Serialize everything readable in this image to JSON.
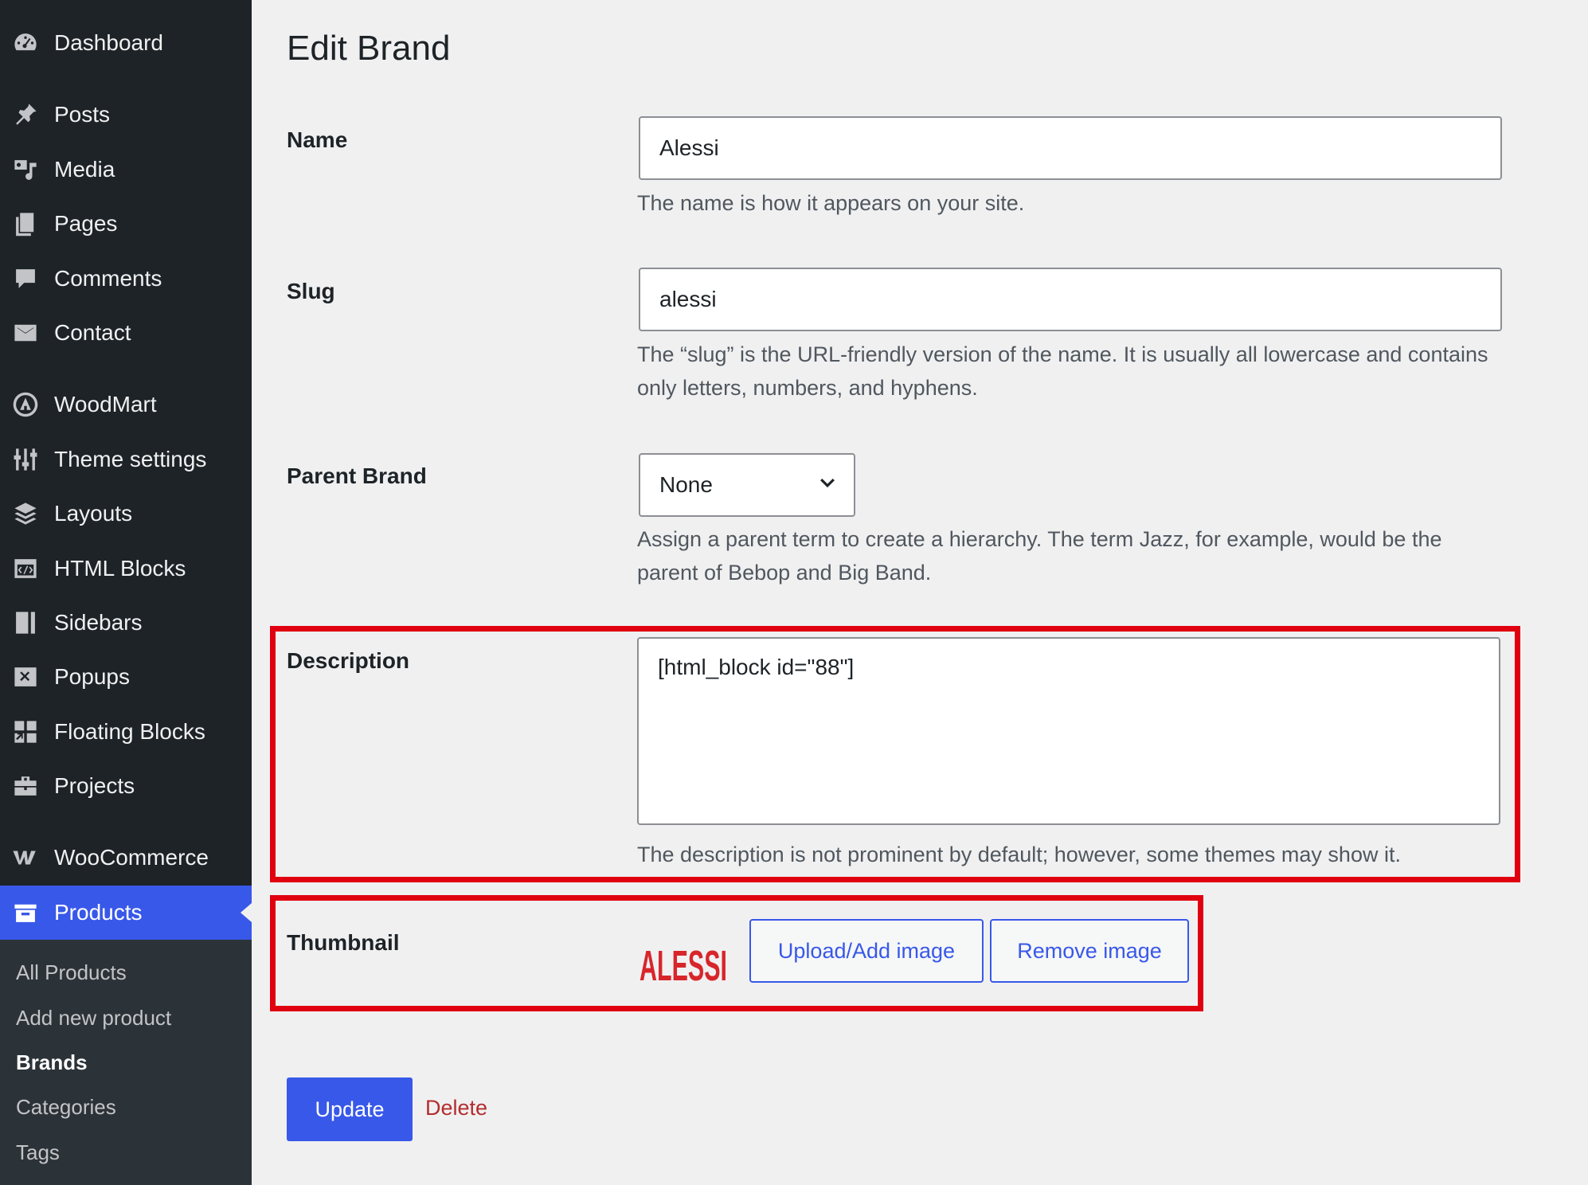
{
  "sidebar": {
    "items": [
      {
        "label": "Dashboard",
        "icon": "dashboard-icon"
      },
      {
        "label": "Posts",
        "icon": "pin-icon"
      },
      {
        "label": "Media",
        "icon": "media-icon"
      },
      {
        "label": "Pages",
        "icon": "pages-icon"
      },
      {
        "label": "Comments",
        "icon": "comment-icon"
      },
      {
        "label": "Contact",
        "icon": "envelope-icon"
      },
      {
        "label": "WoodMart",
        "icon": "woodmart-icon"
      },
      {
        "label": "Theme settings",
        "icon": "sliders-icon"
      },
      {
        "label": "Layouts",
        "icon": "layers-icon"
      },
      {
        "label": "HTML Blocks",
        "icon": "code-block-icon"
      },
      {
        "label": "Sidebars",
        "icon": "sidebar-icon"
      },
      {
        "label": "Popups",
        "icon": "popup-icon"
      },
      {
        "label": "Floating Blocks",
        "icon": "floating-blocks-icon"
      },
      {
        "label": "Projects",
        "icon": "briefcase-icon"
      },
      {
        "label": "WooCommerce",
        "icon": "woocommerce-icon"
      },
      {
        "label": "Products",
        "icon": "products-icon",
        "active": true
      }
    ],
    "submenu": [
      {
        "label": "All Products"
      },
      {
        "label": "Add new product"
      },
      {
        "label": "Brands",
        "current": true
      },
      {
        "label": "Categories"
      },
      {
        "label": "Tags"
      }
    ]
  },
  "page": {
    "title": "Edit Brand"
  },
  "form": {
    "name": {
      "label": "Name",
      "value": "Alessi",
      "help": "The name is how it appears on your site."
    },
    "slug": {
      "label": "Slug",
      "value": "alessi",
      "help": "The “slug” is the URL-friendly version of the name. It is usually all lowercase and contains only letters, numbers, and hyphens."
    },
    "parent": {
      "label": "Parent Brand",
      "selected": "None",
      "help": "Assign a parent term to create a hierarchy. The term Jazz, for example, would be the parent of Bebop and Big Band."
    },
    "description": {
      "label": "Description",
      "value": "[html_block id=\"88\"]",
      "help": "The description is not prominent by default; however, some themes may show it."
    },
    "thumbnail": {
      "label": "Thumbnail",
      "logo_text": "ALESSI",
      "upload_label": "Upload/Add image",
      "remove_label": "Remove image"
    }
  },
  "actions": {
    "update_label": "Update",
    "delete_label": "Delete"
  },
  "colors": {
    "sidebar_bg": "#1d2327",
    "accent": "#3858e9",
    "highlight": "#e0000f",
    "delete": "#b32d2e",
    "logo": "#d7262b"
  }
}
